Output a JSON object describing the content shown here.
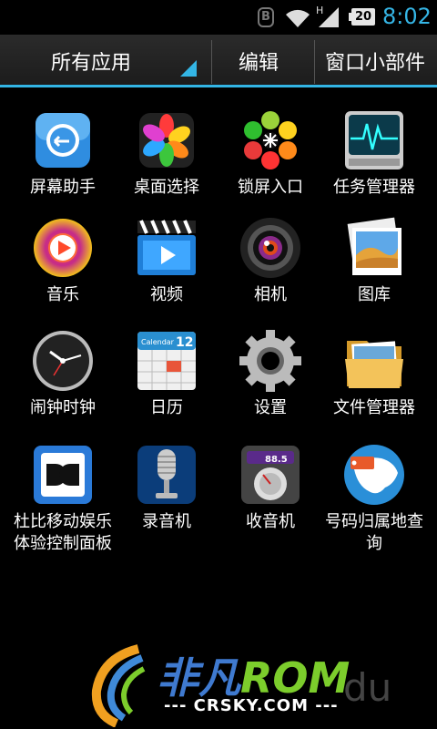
{
  "status_bar": {
    "time": "8:02",
    "battery": "20",
    "b_badge": "B",
    "network_letter": "H",
    "icons": [
      "b-notification-icon",
      "wifi-icon",
      "signal-icon",
      "battery-icon"
    ]
  },
  "tabs": {
    "all_apps": "所有应用",
    "edit": "编辑",
    "widgets": "窗口小部件"
  },
  "apps": [
    {
      "label": "屏幕助手",
      "icon": "screen-assistant-icon"
    },
    {
      "label": "桌面选择",
      "icon": "launcher-picker-icon"
    },
    {
      "label": "锁屏入口",
      "icon": "lockscreen-icon"
    },
    {
      "label": "任务管理器",
      "icon": "task-manager-icon"
    },
    {
      "label": "音乐",
      "icon": "music-icon"
    },
    {
      "label": "视频",
      "icon": "video-icon"
    },
    {
      "label": "相机",
      "icon": "camera-icon"
    },
    {
      "label": "图库",
      "icon": "gallery-icon"
    },
    {
      "label": "闹钟时钟",
      "icon": "clock-icon"
    },
    {
      "label": "日历",
      "icon": "calendar-icon"
    },
    {
      "label": "设置",
      "icon": "settings-icon"
    },
    {
      "label": "文件管理器",
      "icon": "file-manager-icon"
    },
    {
      "label": "杜比移动娱乐体验控制面板",
      "icon": "dolby-icon"
    },
    {
      "label": "录音机",
      "icon": "recorder-icon"
    },
    {
      "label": "收音机",
      "icon": "radio-icon"
    },
    {
      "label": "号码归属地查询",
      "icon": "number-location-icon"
    }
  ],
  "icon_text": {
    "calendar_header": "Calendar",
    "calendar_day": "12",
    "radio_freq": "88.5"
  },
  "watermark": {
    "brand_1": "非凡",
    "brand_2": "ROM",
    "url": "--- CRSKY.COM ---",
    "du": "du"
  },
  "colors": {
    "accent": "#33b5e5",
    "time": "#35b5e5"
  }
}
